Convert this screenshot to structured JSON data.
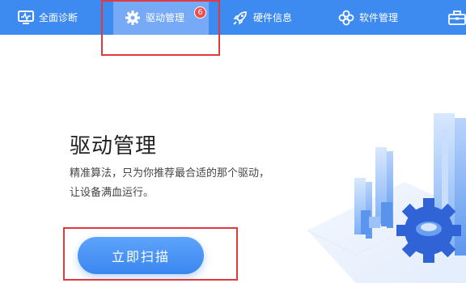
{
  "nav": {
    "tabs": [
      {
        "label": "全面诊断",
        "icon": "monitor-icon"
      },
      {
        "label": "驱动管理",
        "icon": "gear-icon",
        "badge": "6",
        "active": true
      },
      {
        "label": "硬件信息",
        "icon": "rocket-icon"
      },
      {
        "label": "软件管理",
        "icon": "flower-icon"
      },
      {
        "label": "",
        "icon": "toolbox-icon"
      }
    ]
  },
  "main": {
    "title": "驱动管理",
    "desc_line1": "精准算法，只为你推荐最合适的那个驱动，",
    "desc_line2": "让设备满血运行。",
    "scan_button": "立即扫描"
  },
  "colors": {
    "nav_bg": "#3d8af0",
    "nav_active": "#77aaf6",
    "badge": "#f04a4a",
    "highlight": "#e0393e",
    "button": "#3a86f0"
  }
}
